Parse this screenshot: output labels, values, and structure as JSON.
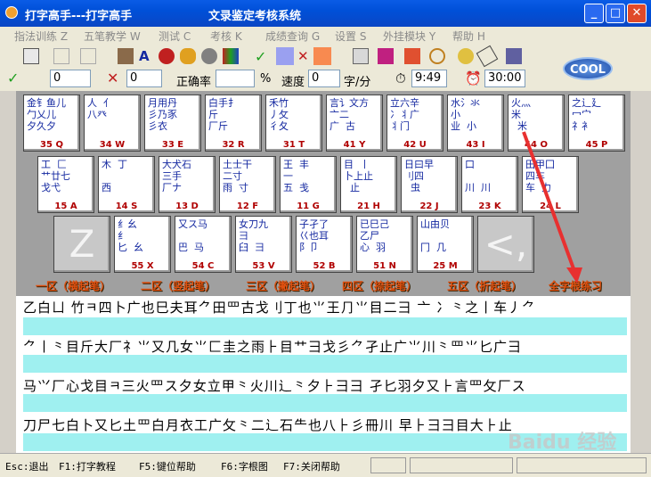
{
  "window": {
    "app_title": "打字高手---打字高手",
    "center_title": "文录鉴定考核系统"
  },
  "menu": [
    "指法训练 Z",
    "五笔教学 W",
    "测试 C",
    "考核 K",
    "成绩查询 G",
    "设置 S",
    "外挂模块 Y",
    "帮助 H"
  ],
  "toolbar": {
    "correct_count": "0",
    "wrong_count": "0",
    "accuracy_label": "正确率",
    "accuracy_value": "",
    "percent": "%",
    "speed_label": "速度",
    "speed_value": "0",
    "speed_unit": "字/分",
    "elapsed_time": "9:49",
    "limit_time": "30:00",
    "logo": "COOL"
  },
  "keyboard": {
    "row1": [
      {
        "roots": "金钅鱼儿\n勹乂儿\n夕久夕",
        "code": "35 Q"
      },
      {
        "roots": "人  亻\n八癶\n",
        "code": "34 W"
      },
      {
        "roots": "月用丹\n彡乃豕\n彡衣",
        "code": "33 E"
      },
      {
        "roots": "白手扌\n斤\n厂斤",
        "code": "32 R"
      },
      {
        "roots": "禾竹\n丿攵\n彳夂",
        "code": "31 T"
      },
      {
        "roots": "言讠文方\n亠二\n广  古",
        "code": "41 Y"
      },
      {
        "roots": "立六辛\n冫丬广\n丬门",
        "code": "42 U"
      },
      {
        "roots": "水氵氺\n小\n业  小",
        "code": "43 I"
      },
      {
        "roots": "火灬\n米\n  米",
        "code": "44 O"
      },
      {
        "roots": "之辶廴\n冖宀\n礻衤",
        "code": "45 P"
      }
    ],
    "row2": [
      {
        "roots": "工  匚\n艹廿七\n戈弋",
        "code": "15 A"
      },
      {
        "roots": "木  丁\n\n西",
        "code": "14 S"
      },
      {
        "roots": "大犬石\n三手\n厂ナ",
        "code": "13 D"
      },
      {
        "roots": "土士干\n二寸\n雨  寸",
        "code": "12 F"
      },
      {
        "roots": "王  丰\n一\n五  戋",
        "code": "11 G"
      },
      {
        "roots": "目  丨\n卜上止\n  止",
        "code": "21 H"
      },
      {
        "roots": "日曰早\n刂四\n  虫",
        "code": "22 J"
      },
      {
        "roots": "口\n\n川  川",
        "code": "23 K"
      },
      {
        "roots": "田甲囗\n四车\n车  力",
        "code": "24 L"
      }
    ],
    "row3": [
      {
        "roots": "",
        "code": "",
        "big": "Z"
      },
      {
        "roots": "纟幺\n纟\n匕  幺",
        "code": "55 X"
      },
      {
        "roots": "又ス马\n\n巴  马",
        "code": "54 C"
      },
      {
        "roots": "女刀九\n彐\n臼  彐",
        "code": "53 V"
      },
      {
        "roots": "子孑了\n巜也耳\n阝卩",
        "code": "52 B"
      },
      {
        "roots": "已巳己\n乙尸\n心  羽",
        "code": "51 N"
      },
      {
        "roots": "山由贝\n\n冂  几",
        "code": "25 M"
      },
      {
        "roots": "",
        "code": "",
        "big": "<,"
      }
    ]
  },
  "zones": [
    "一区（横起笔）",
    "二区（竖起笔）",
    "三区（撇起笔）",
    "四区（捺起笔）",
    "五区（折起笔）",
    "全字根练习"
  ],
  "practice": [
    "乙白ㄩ 竹ㅋ四卜广也巳夫耳⺈田罒古戈刂丁也⺌王⺆⺌目二⺕ 亠 冫⺀之丨车丿⺈",
    "⺈丨⺀目斤大厂礻⺌又几女⺌匚圭之雨⺊目⺾⺕戈彡⺈孑止广⺌川⺀罒⺌匕广⺕",
    "马⺍厂心戈目ㅋ三火罒ス夕女立甲⺀火川辶⺀夕⺊⺕⺕ 孑匕羽夕又⺊言罒攵厂ス",
    "刀尸七白卜又匕土罒白月衣工广攵⺀二辶石⺧也八⺊彡冊川 早⺊⺕⺕目大⺊止"
  ],
  "status": [
    "Esc:退出",
    "F1:打字教程",
    "F5:键位帮助",
    "F6:字根图",
    "F7:关闭帮助"
  ],
  "watermark": "Baidu 经验",
  "colors": {
    "title_bar": "#0a5ce6",
    "root_text": "#1428a0",
    "code_text": "#b00000",
    "zone_text": "#e05010",
    "practice_band": "#9ff0f0",
    "arrow": "#e83030"
  }
}
